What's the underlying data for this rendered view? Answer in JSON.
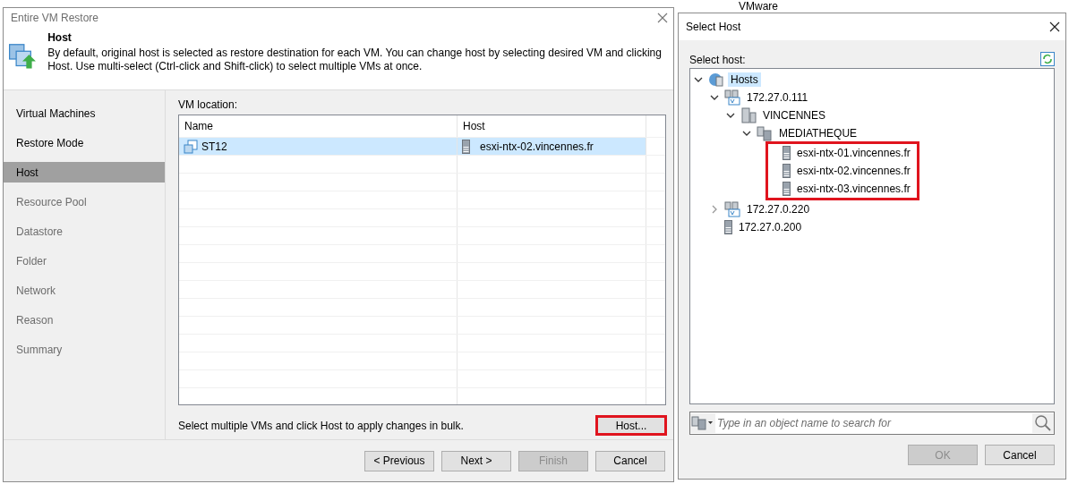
{
  "background": {
    "column_text": "VMware"
  },
  "restore_wizard": {
    "title": "Entire VM Restore",
    "step_title": "Host",
    "step_description": "By default, original host is selected as restore destination for each VM. You can change host by selecting desired VM and clicking Host. Use multi-select (Ctrl-click and Shift-click) to select multiple VMs at once.",
    "steps": [
      {
        "label": "Virtual Machines",
        "selected": false,
        "disabled": false
      },
      {
        "label": "Restore Mode",
        "selected": false,
        "disabled": false
      },
      {
        "label": "Host",
        "selected": true,
        "disabled": false
      },
      {
        "label": "Resource Pool",
        "selected": false,
        "disabled": true
      },
      {
        "label": "Datastore",
        "selected": false,
        "disabled": true
      },
      {
        "label": "Folder",
        "selected": false,
        "disabled": true
      },
      {
        "label": "Network",
        "selected": false,
        "disabled": true
      },
      {
        "label": "Reason",
        "selected": false,
        "disabled": true
      },
      {
        "label": "Summary",
        "selected": false,
        "disabled": true
      }
    ],
    "vm_location_label": "VM location:",
    "table": {
      "columns": [
        "Name",
        "Host"
      ],
      "rows": [
        {
          "name": "ST12",
          "host": "esxi-ntx-02.vincennes.fr",
          "selected": true
        }
      ]
    },
    "bulk_hint": "Select multiple VMs and click Host to apply changes in bulk.",
    "host_button": {
      "label": "Host...",
      "highlighted": true
    },
    "buttons": [
      {
        "label": "< Previous",
        "disabled": false
      },
      {
        "label": "Next >",
        "disabled": false
      },
      {
        "label": "Finish",
        "disabled": true
      },
      {
        "label": "Cancel",
        "disabled": false
      }
    ]
  },
  "select_host": {
    "title": "Select Host",
    "prompt": "Select host:",
    "tree": [
      {
        "label": "Hosts",
        "kind": "root",
        "expanded": true,
        "selected": true,
        "children": [
          {
            "label": "172.27.0.111",
            "kind": "vcenter",
            "expanded": true,
            "selected": false,
            "children": [
              {
                "label": "VINCENNES",
                "kind": "datacenter",
                "expanded": true,
                "selected": false,
                "children": [
                  {
                    "label": "MEDIATHEQUE",
                    "kind": "cluster",
                    "expanded": true,
                    "selected": false,
                    "children_highlighted": true,
                    "children": [
                      {
                        "label": "esxi-ntx-01.vincennes.fr",
                        "kind": "host",
                        "selected": false
                      },
                      {
                        "label": "esxi-ntx-02.vincennes.fr",
                        "kind": "host",
                        "selected": false
                      },
                      {
                        "label": "esxi-ntx-03.vincennes.fr",
                        "kind": "host",
                        "selected": false
                      }
                    ]
                  }
                ]
              }
            ]
          },
          {
            "label": "172.27.0.220",
            "kind": "vcenter",
            "expanded": false,
            "selected": false
          },
          {
            "label": "172.27.0.200",
            "kind": "host",
            "selected": false
          }
        ]
      }
    ],
    "search": {
      "placeholder": "Type in an object name to search for"
    },
    "buttons": [
      {
        "label": "OK",
        "disabled": true
      },
      {
        "label": "Cancel",
        "disabled": false
      }
    ]
  }
}
